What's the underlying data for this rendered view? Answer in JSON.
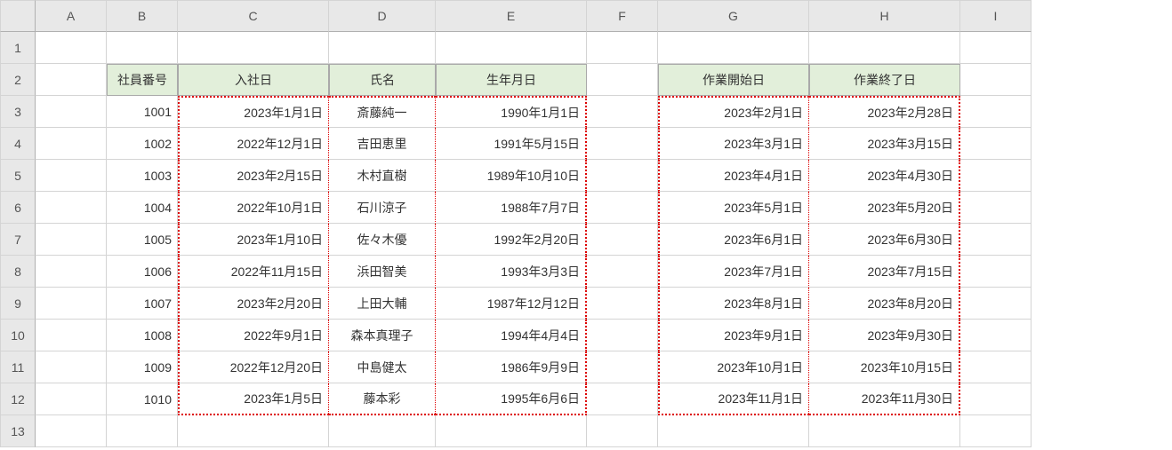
{
  "columns": [
    "A",
    "B",
    "C",
    "D",
    "E",
    "F",
    "G",
    "H",
    "I"
  ],
  "rowCount": 13,
  "headers": {
    "empno": "社員番号",
    "hire": "入社日",
    "name": "氏名",
    "dob": "生年月日",
    "start": "作業開始日",
    "end": "作業終了日"
  },
  "rows": [
    {
      "empno": "1001",
      "hire": "2023年1月1日",
      "name": "斎藤純一",
      "dob": "1990年1月1日",
      "start": "2023年2月1日",
      "end": "2023年2月28日"
    },
    {
      "empno": "1002",
      "hire": "2022年12月1日",
      "name": "吉田恵里",
      "dob": "1991年5月15日",
      "start": "2023年3月1日",
      "end": "2023年3月15日"
    },
    {
      "empno": "1003",
      "hire": "2023年2月15日",
      "name": "木村直樹",
      "dob": "1989年10月10日",
      "start": "2023年4月1日",
      "end": "2023年4月30日"
    },
    {
      "empno": "1004",
      "hire": "2022年10月1日",
      "name": "石川涼子",
      "dob": "1988年7月7日",
      "start": "2023年5月1日",
      "end": "2023年5月20日"
    },
    {
      "empno": "1005",
      "hire": "2023年1月10日",
      "name": "佐々木優",
      "dob": "1992年2月20日",
      "start": "2023年6月1日",
      "end": "2023年6月30日"
    },
    {
      "empno": "1006",
      "hire": "2022年11月15日",
      "name": "浜田智美",
      "dob": "1993年3月3日",
      "start": "2023年7月1日",
      "end": "2023年7月15日"
    },
    {
      "empno": "1007",
      "hire": "2023年2月20日",
      "name": "上田大輔",
      "dob": "1987年12月12日",
      "start": "2023年8月1日",
      "end": "2023年8月20日"
    },
    {
      "empno": "1008",
      "hire": "2022年9月1日",
      "name": "森本真理子",
      "dob": "1994年4月4日",
      "start": "2023年9月1日",
      "end": "2023年9月30日"
    },
    {
      "empno": "1009",
      "hire": "2022年12月20日",
      "name": "中島健太",
      "dob": "1986年9月9日",
      "start": "2023年10月1日",
      "end": "2023年10月15日"
    },
    {
      "empno": "1010",
      "hire": "2023年1月5日",
      "name": "藤本彩",
      "dob": "1995年6月6日",
      "start": "2023年11月1日",
      "end": "2023年11月30日"
    }
  ]
}
